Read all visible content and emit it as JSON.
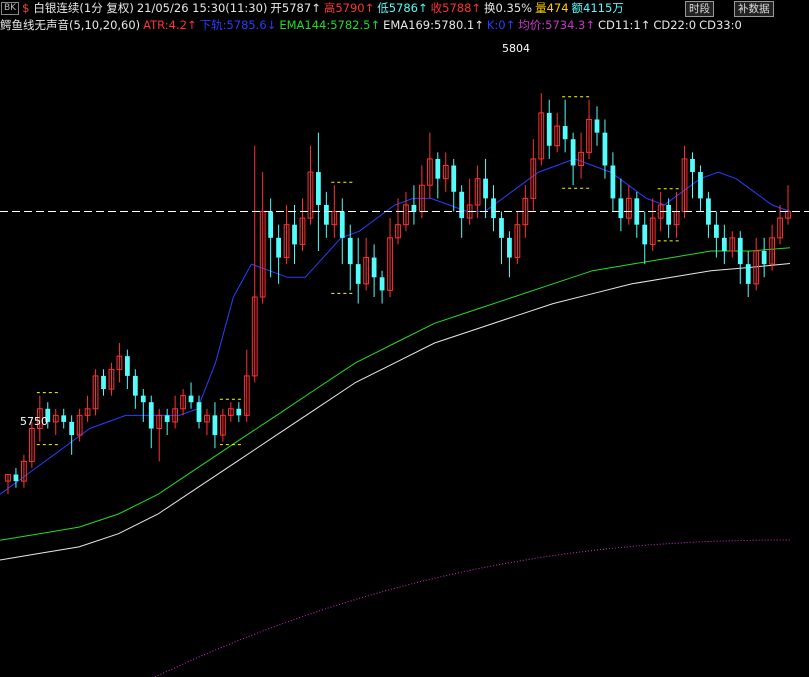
{
  "header": {
    "badge": "BK",
    "symbol_glyph": "$",
    "symbol_name": "白银连续(1分 复权)",
    "datetime": "21/05/26 15:30(11:30)",
    "open": "开5787↑",
    "high": "高5790↑",
    "low": "低5786↑",
    "close": "收5788↑",
    "turnover": "换0.35%",
    "volume": "量474",
    "amount": "额4115万"
  },
  "buttons": {
    "timeshare": "时段",
    "supplement": "补数据"
  },
  "indicators": {
    "name": "鳄鱼线无声音(5,10,20,60)",
    "atr": "ATR:4.2↑",
    "lower_rail": "下轨:5785.6↓",
    "ema144": "EMA144:5782.5↑",
    "ema169": "EMA169:5780.1↑",
    "k": "K:0↑",
    "avg": "均价:5734.3↑",
    "cd11": "CD11:1↑",
    "cd22": "CD22:0",
    "cd33": "CD33:0"
  },
  "colors": {
    "up": "#ff3232",
    "down": "#54fcfc",
    "flat": "#9a9a9a",
    "blue_line": "#2a3cff",
    "ema144": "#22dd22",
    "ema169": "#e8e8e8",
    "avg_price": "#cc33cc",
    "marker": "#ffff00",
    "dash_line": "#ffffff"
  },
  "chart_data": {
    "type": "candlestick",
    "price_range": [
      5735,
      5815
    ],
    "labels": {
      "low_mark": "5750",
      "high_mark": "5804"
    },
    "current_price_line": 5788,
    "candles": [
      [
        5747,
        5748,
        5745,
        5748
      ],
      [
        5748,
        5747,
        5746,
        5749
      ],
      [
        5747,
        5750,
        5746,
        5751
      ],
      [
        5750,
        5755,
        5749,
        5756
      ],
      [
        5755,
        5758,
        5753,
        5760
      ],
      [
        5758,
        5756,
        5755,
        5759
      ],
      [
        5756,
        5757,
        5754,
        5758
      ],
      [
        5757,
        5756,
        5755,
        5758
      ],
      [
        5756,
        5754,
        5751,
        5757
      ],
      [
        5754,
        5757,
        5753,
        5758
      ],
      [
        5757,
        5758,
        5756,
        5760
      ],
      [
        5758,
        5763,
        5757,
        5764
      ],
      [
        5763,
        5761,
        5760,
        5764
      ],
      [
        5761,
        5764,
        5760,
        5765
      ],
      [
        5764,
        5766,
        5762,
        5768
      ],
      [
        5766,
        5763,
        5761,
        5767
      ],
      [
        5763,
        5760,
        5758,
        5764
      ],
      [
        5760,
        5759,
        5756,
        5761
      ],
      [
        5759,
        5755,
        5752,
        5760
      ],
      [
        5755,
        5757,
        5750,
        5758
      ],
      [
        5757,
        5756,
        5754,
        5758
      ],
      [
        5756,
        5758,
        5755,
        5760
      ],
      [
        5758,
        5760,
        5757,
        5761
      ],
      [
        5760,
        5759,
        5758,
        5762
      ],
      [
        5759,
        5756,
        5755,
        5760
      ],
      [
        5756,
        5757,
        5754,
        5758
      ],
      [
        5757,
        5754,
        5752,
        5759
      ],
      [
        5754,
        5757,
        5753,
        5758
      ],
      [
        5757,
        5758,
        5756,
        5759
      ],
      [
        5758,
        5757,
        5756,
        5759
      ],
      [
        5757,
        5763,
        5756,
        5767
      ],
      [
        5763,
        5775,
        5762,
        5798
      ],
      [
        5775,
        5788,
        5774,
        5794
      ],
      [
        5788,
        5784,
        5778,
        5790
      ],
      [
        5784,
        5781,
        5777,
        5786
      ],
      [
        5781,
        5786,
        5780,
        5789
      ],
      [
        5786,
        5783,
        5780,
        5789
      ],
      [
        5783,
        5787,
        5782,
        5790
      ],
      [
        5787,
        5794,
        5786,
        5798
      ],
      [
        5794,
        5789,
        5782,
        5800
      ],
      [
        5789,
        5786,
        5784,
        5791
      ],
      [
        5786,
        5788,
        5784,
        5792
      ],
      [
        5788,
        5784,
        5780,
        5790
      ],
      [
        5784,
        5780,
        5776,
        5786
      ],
      [
        5780,
        5777,
        5774,
        5784
      ],
      [
        5777,
        5781,
        5776,
        5784
      ],
      [
        5781,
        5778,
        5775,
        5783
      ],
      [
        5778,
        5776,
        5774,
        5779
      ],
      [
        5776,
        5784,
        5775,
        5787
      ],
      [
        5784,
        5786,
        5783,
        5790
      ],
      [
        5786,
        5789,
        5785,
        5791
      ],
      [
        5789,
        5788,
        5786,
        5792
      ],
      [
        5788,
        5792,
        5787,
        5795
      ],
      [
        5792,
        5796,
        5790,
        5800
      ],
      [
        5796,
        5793,
        5790,
        5797
      ],
      [
        5793,
        5795,
        5791,
        5797
      ],
      [
        5795,
        5791,
        5788,
        5796
      ],
      [
        5791,
        5787,
        5784,
        5792
      ],
      [
        5787,
        5789,
        5786,
        5793
      ],
      [
        5789,
        5793,
        5787,
        5795
      ],
      [
        5793,
        5790,
        5787,
        5796
      ],
      [
        5790,
        5787,
        5785,
        5792
      ],
      [
        5787,
        5784,
        5780,
        5788
      ],
      [
        5784,
        5781,
        5778,
        5785
      ],
      [
        5781,
        5786,
        5780,
        5788
      ],
      [
        5786,
        5790,
        5784,
        5792
      ],
      [
        5790,
        5796,
        5788,
        5799
      ],
      [
        5796,
        5803,
        5795,
        5806
      ],
      [
        5803,
        5798,
        5796,
        5805
      ],
      [
        5798,
        5801,
        5797,
        5803
      ],
      [
        5801,
        5799,
        5797,
        5805
      ],
      [
        5799,
        5795,
        5792,
        5800
      ],
      [
        5795,
        5797,
        5793,
        5800
      ],
      [
        5797,
        5802,
        5796,
        5805
      ],
      [
        5802,
        5800,
        5798,
        5804
      ],
      [
        5800,
        5795,
        5793,
        5802
      ],
      [
        5795,
        5790,
        5788,
        5797
      ],
      [
        5790,
        5787,
        5785,
        5793
      ],
      [
        5787,
        5790,
        5786,
        5792
      ],
      [
        5790,
        5786,
        5784,
        5791
      ],
      [
        5786,
        5783,
        5780,
        5788
      ],
      [
        5783,
        5787,
        5782,
        5790
      ],
      [
        5787,
        5789,
        5785,
        5791
      ],
      [
        5789,
        5786,
        5784,
        5790
      ],
      [
        5786,
        5788,
        5784,
        5791
      ],
      [
        5788,
        5796,
        5787,
        5798
      ],
      [
        5796,
        5794,
        5790,
        5797
      ],
      [
        5794,
        5790,
        5788,
        5795
      ],
      [
        5790,
        5786,
        5784,
        5791
      ],
      [
        5786,
        5784,
        5781,
        5788
      ],
      [
        5784,
        5782,
        5780,
        5786
      ],
      [
        5782,
        5784,
        5781,
        5785
      ],
      [
        5784,
        5780,
        5777,
        5785
      ],
      [
        5780,
        5777,
        5775,
        5782
      ],
      [
        5777,
        5782,
        5776,
        5784
      ],
      [
        5782,
        5780,
        5778,
        5784
      ],
      [
        5780,
        5784,
        5779,
        5786
      ],
      [
        5784,
        5787,
        5783,
        5789
      ],
      [
        5787,
        5788,
        5786,
        5792
      ]
    ],
    "lines": {
      "blue_rail": [
        5745,
        5747,
        5749,
        5751,
        5753,
        5755,
        5756,
        5757,
        5757,
        5757,
        5757,
        5758,
        5765,
        5775,
        5780,
        5779,
        5778,
        5778,
        5781,
        5784,
        5785,
        5787,
        5789,
        5790,
        5790,
        5789,
        5788,
        5788,
        5790,
        5792,
        5794,
        5795,
        5796,
        5795,
        5794,
        5792,
        5790,
        5789,
        5791,
        5793,
        5794,
        5793,
        5791,
        5789,
        5788
      ],
      "ema144": [
        5738,
        5739,
        5740,
        5742,
        5745,
        5749,
        5753,
        5757,
        5761,
        5765,
        5768,
        5771,
        5773,
        5775,
        5777,
        5779,
        5780,
        5781,
        5782,
        5782,
        5782.5
      ],
      "ema169": [
        5735,
        5736,
        5737,
        5739,
        5742,
        5746,
        5750,
        5754,
        5758,
        5762,
        5765,
        5768,
        5770,
        5772,
        5774,
        5775.5,
        5777,
        5778,
        5779,
        5779.5,
        5780.1
      ]
    }
  }
}
